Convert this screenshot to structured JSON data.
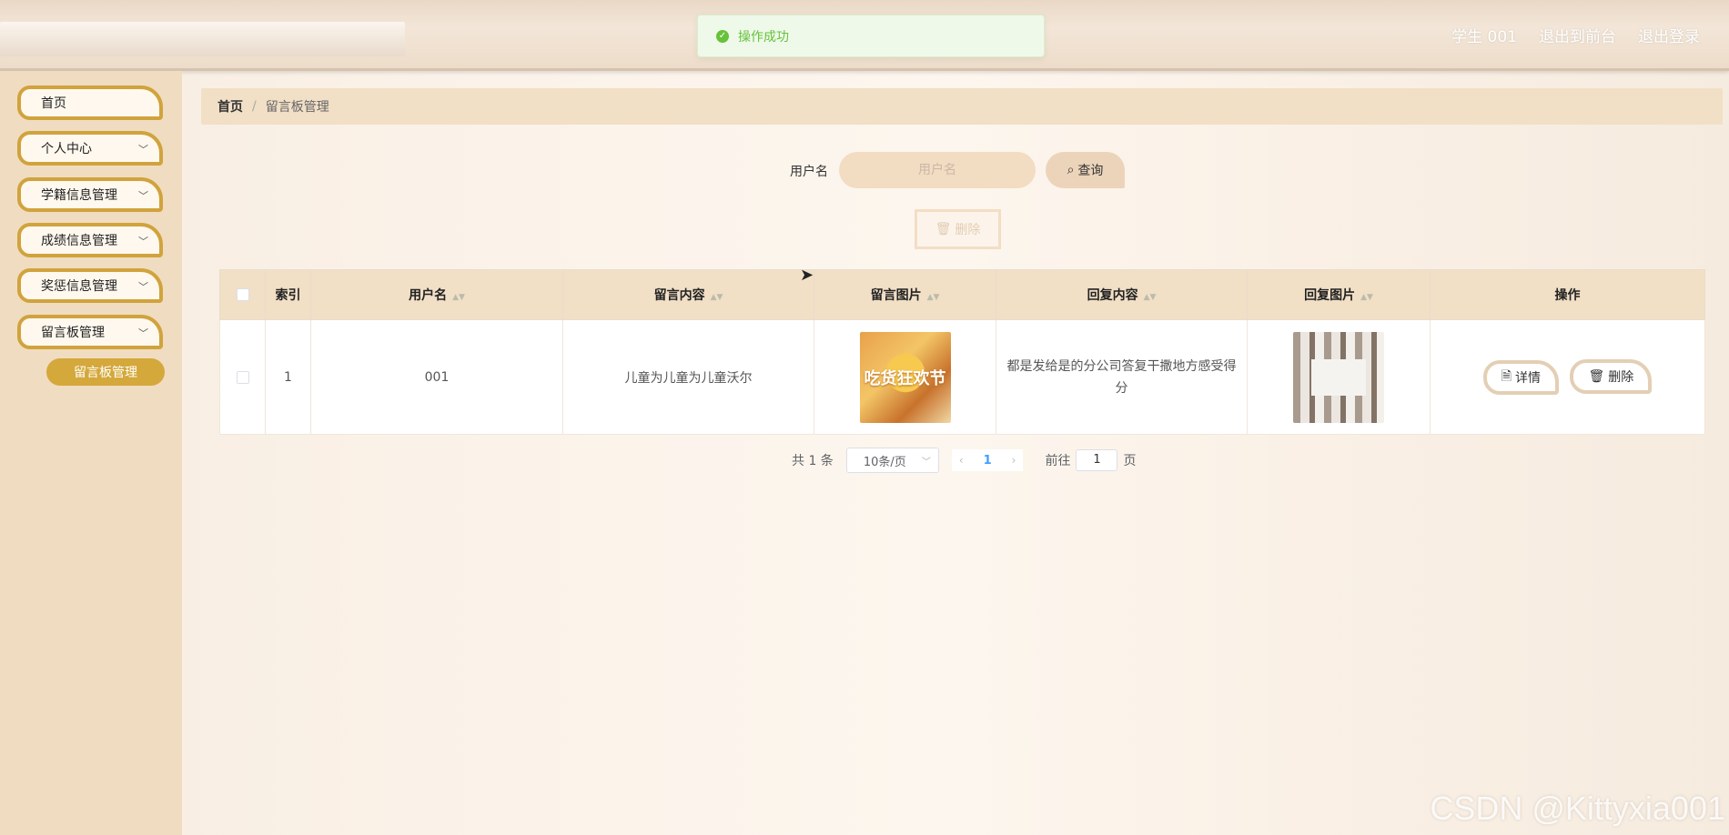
{
  "header": {
    "user": "学生 001",
    "to_front": "退出到前台",
    "logout": "退出登录"
  },
  "toast": {
    "message": "操作成功"
  },
  "sidebar": {
    "items": [
      {
        "label": "首页",
        "has_children": false
      },
      {
        "label": "个人中心",
        "has_children": true
      },
      {
        "label": "学籍信息管理",
        "has_children": true
      },
      {
        "label": "成绩信息管理",
        "has_children": true
      },
      {
        "label": "奖惩信息管理",
        "has_children": true
      },
      {
        "label": "留言板管理",
        "has_children": true
      }
    ],
    "active_sub": "留言板管理"
  },
  "breadcrumb": {
    "home": "首页",
    "current": "留言板管理"
  },
  "search": {
    "label": "用户名",
    "placeholder": "用户名",
    "button": "查询"
  },
  "toolbar": {
    "delete_label": "删除"
  },
  "table": {
    "columns": {
      "index": "索引",
      "username": "用户名",
      "content": "留言内容",
      "image": "留言图片",
      "reply": "回复内容",
      "reply_image": "回复图片",
      "actions": "操作"
    },
    "rows": [
      {
        "index": "1",
        "username": "001",
        "content": "儿童为儿童为儿童沃尔",
        "image_text": "吃货狂欢节",
        "reply": "都是发给是的分公司答复干撒地方感受得分",
        "detail_label": "详情",
        "delete_label": "删除"
      }
    ]
  },
  "pagination": {
    "total": "共 1 条",
    "page_size": "10条/页",
    "current_page": "1",
    "goto_label": "前往",
    "goto_value": "1",
    "page_suffix": "页"
  },
  "watermark": "CSDN @Kittyxia001",
  "colors": {
    "accent": "#d4a83a",
    "sidebar_bg": "#f0dcc0",
    "success": "#67c23a"
  }
}
